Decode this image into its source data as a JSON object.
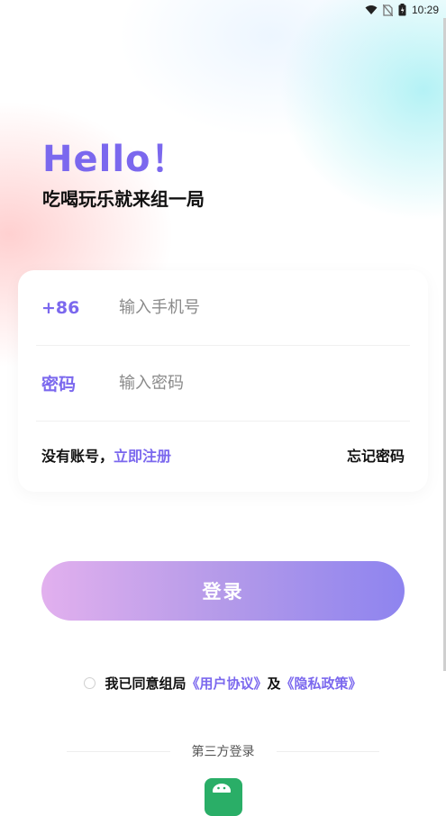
{
  "status_bar": {
    "time": "10:29"
  },
  "header": {
    "greeting": "Hello！",
    "slogan": "吃喝玩乐就来组一局"
  },
  "form": {
    "phone_prefix": "+86",
    "phone_placeholder": "输入手机号",
    "password_label": "密码",
    "password_placeholder": "输入密码",
    "no_account_text": "没有账号，",
    "register_link": "立即注册",
    "forgot_password": "忘记密码"
  },
  "login_button": "登录",
  "agreement": {
    "prefix": "我已同意组局",
    "user_agreement": "《用户协议》",
    "and": "及",
    "privacy_policy": "《隐私政策》"
  },
  "third_party": {
    "label": "第三方登录",
    "options": [
      "wechat-icon"
    ]
  },
  "colors": {
    "accent": "#7b68ee",
    "button_gradient_start": "#e2b0ee",
    "button_gradient_end": "#8e84ef",
    "wechat_green": "#2aae67"
  }
}
